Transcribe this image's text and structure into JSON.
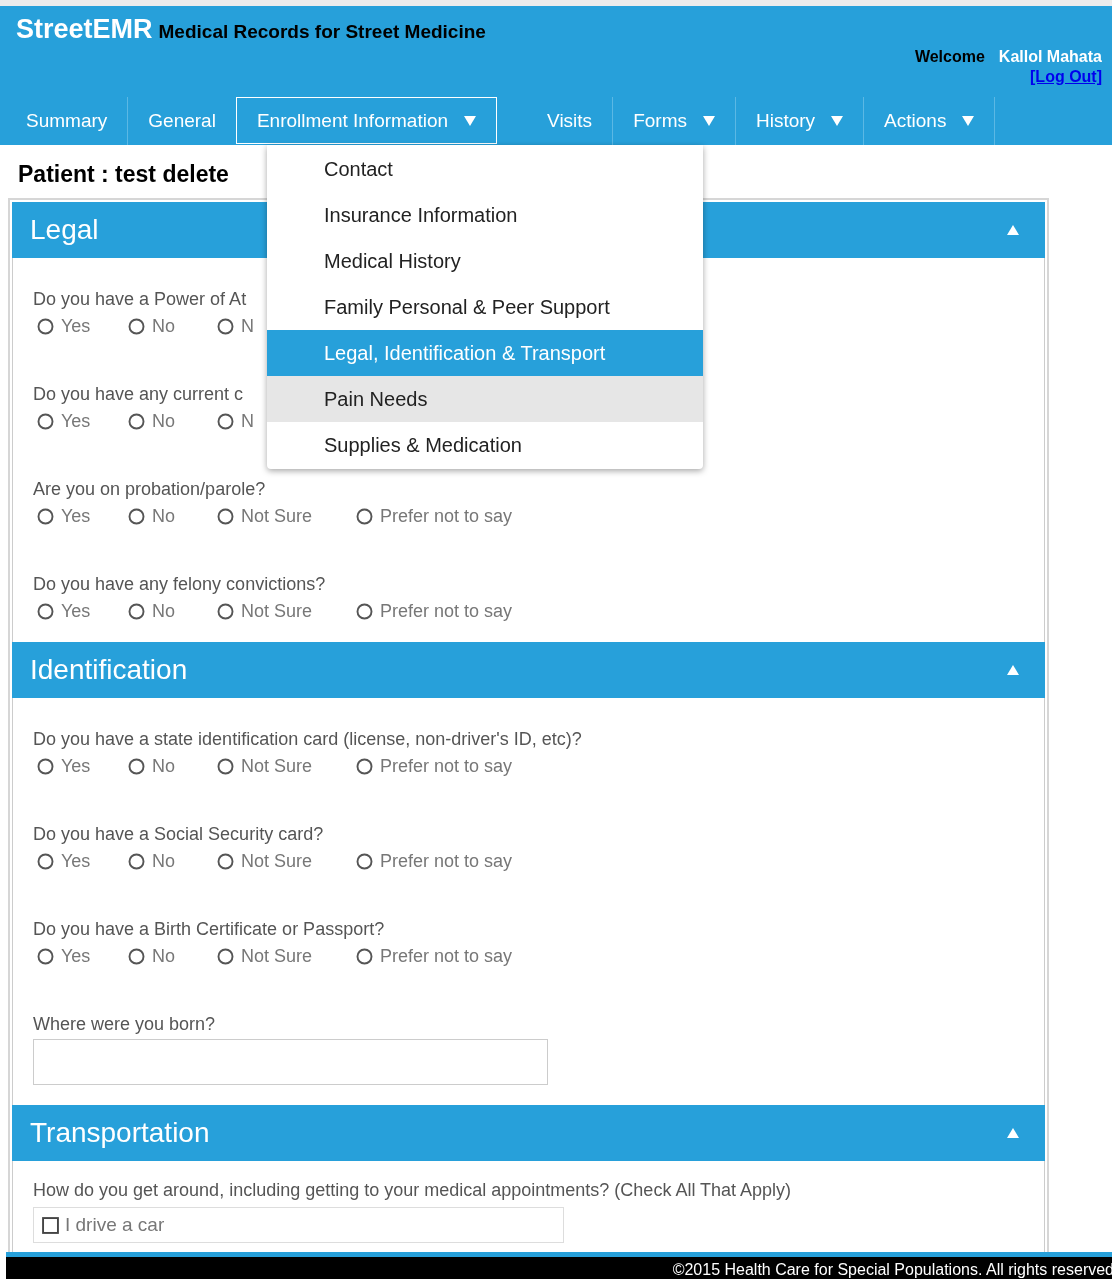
{
  "header": {
    "brand": "StreetEMR",
    "tagline": "Medical Records for Street Medicine",
    "welcome": "Welcome",
    "user": "Kallol Mahata",
    "logout": "[Log Out]"
  },
  "nav": [
    {
      "label": "Summary",
      "selected": false,
      "menu": false
    },
    {
      "label": "General",
      "selected": false,
      "menu": false
    },
    {
      "label": "Enrollment Information",
      "selected": true,
      "menu": true
    },
    {
      "label": "Visits",
      "selected": false,
      "menu": false
    },
    {
      "label": "Forms",
      "selected": false,
      "menu": true
    },
    {
      "label": "History",
      "selected": false,
      "menu": true
    },
    {
      "label": "Actions",
      "selected": false,
      "menu": true
    }
  ],
  "dropdown": [
    {
      "label": "Contact",
      "selected": false,
      "hovered": false
    },
    {
      "label": "Insurance Information",
      "selected": false,
      "hovered": false
    },
    {
      "label": "Medical History",
      "selected": false,
      "hovered": false
    },
    {
      "label": "Family Personal & Peer Support",
      "selected": false,
      "hovered": false
    },
    {
      "label": "Legal, Identification & Transport",
      "selected": true,
      "hovered": false
    },
    {
      "label": "Pain Needs",
      "selected": false,
      "hovered": true
    },
    {
      "label": "Supplies & Medication",
      "selected": false,
      "hovered": false
    }
  ],
  "patient": "Patient : test delete",
  "sections": [
    {
      "title": "Legal",
      "expanded": true,
      "questions": [
        {
          "kind": "radio",
          "text": "Do you have a Power of At",
          "options": [
            {
              "label": "Yes",
              "selected": false
            },
            {
              "label": "No",
              "selected": false
            },
            {
              "label": "N",
              "selected": false
            }
          ]
        },
        {
          "kind": "radio",
          "text": "Do you have any current c",
          "options": [
            {
              "label": "Yes",
              "selected": false
            },
            {
              "label": "No",
              "selected": false
            },
            {
              "label": "N",
              "selected": false
            }
          ]
        },
        {
          "kind": "radio",
          "text": "Are you on probation/parole?",
          "options": [
            {
              "label": "Yes",
              "selected": false
            },
            {
              "label": "No",
              "selected": false
            },
            {
              "label": "Not Sure",
              "selected": false
            },
            {
              "label": "Prefer not to say",
              "selected": false
            }
          ]
        },
        {
          "kind": "radio",
          "text": "Do you have any felony convictions?",
          "options": [
            {
              "label": "Yes",
              "selected": false
            },
            {
              "label": "No",
              "selected": false
            },
            {
              "label": "Not Sure",
              "selected": false
            },
            {
              "label": "Prefer not to say",
              "selected": false
            }
          ]
        }
      ]
    },
    {
      "title": "Identification",
      "expanded": true,
      "questions": [
        {
          "kind": "radio",
          "text": "Do you have a state identification card (license, non-driver's ID, etc)?",
          "options": [
            {
              "label": "Yes",
              "selected": false
            },
            {
              "label": "No",
              "selected": false
            },
            {
              "label": "Not Sure",
              "selected": false
            },
            {
              "label": "Prefer not to say",
              "selected": false
            }
          ]
        },
        {
          "kind": "radio",
          "text": "Do you have a Social Security card?",
          "options": [
            {
              "label": "Yes",
              "selected": false
            },
            {
              "label": "No",
              "selected": false
            },
            {
              "label": "Not Sure",
              "selected": false
            },
            {
              "label": "Prefer not to say",
              "selected": false
            }
          ]
        },
        {
          "kind": "radio",
          "text": "Do you have a Birth Certificate or Passport?",
          "options": [
            {
              "label": "Yes",
              "selected": false
            },
            {
              "label": "No",
              "selected": false
            },
            {
              "label": "Not Sure",
              "selected": false
            },
            {
              "label": "Prefer not to say",
              "selected": false
            }
          ]
        },
        {
          "kind": "text",
          "text": "Where were you born?"
        }
      ]
    },
    {
      "title": "Transportation",
      "expanded": true,
      "questions": [
        {
          "kind": "checkbox",
          "text": "How do you get around, including getting to your medical appointments? (Check All That Apply)",
          "options": [
            {
              "label": "I drive a car",
              "checked": false
            }
          ]
        }
      ]
    }
  ],
  "footer": "©2015 Health Care for Special Populations. All rights reserved"
}
